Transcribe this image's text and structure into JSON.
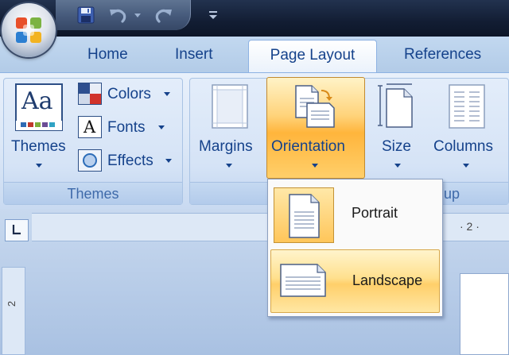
{
  "tabs": [
    {
      "label": "Home",
      "active": false
    },
    {
      "label": "Insert",
      "active": false
    },
    {
      "label": "Page Layout",
      "active": true
    },
    {
      "label": "References",
      "active": false
    }
  ],
  "qat": {
    "icons": [
      "save-icon",
      "undo-icon",
      "redo-icon",
      "customize-qat-icon"
    ]
  },
  "ribbon": {
    "themes_group": {
      "label": "Themes",
      "themes_button": "Themes",
      "colors": "Colors",
      "fonts": "Fonts",
      "effects": "Effects",
      "preview_glyph": "Aa",
      "fonts_glyph": "A"
    },
    "page_setup_group": {
      "label_visible_fragment": "up",
      "margins": "Margins",
      "orientation": "Orientation",
      "size": "Size",
      "columns": "Columns"
    }
  },
  "orientation_menu": {
    "items": [
      {
        "label": "Portrait",
        "selected": true,
        "hovered": false
      },
      {
        "label": "Landscape",
        "selected": false,
        "hovered": true
      }
    ]
  },
  "rulers": {
    "horizontal_fragment": "· 2 ·",
    "vertical_fragment": "2"
  },
  "colors": {
    "title_bar": "#1b2a45",
    "tab_text": "#15428b",
    "ribbon_bg": "#dbe7f7",
    "highlight_orange": "#ffb53c",
    "group_label_text": "#3e6aaa"
  }
}
